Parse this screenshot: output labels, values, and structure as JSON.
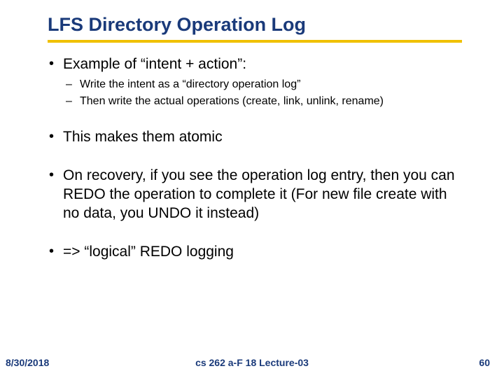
{
  "title": "LFS Directory Operation Log",
  "bullets": [
    {
      "text": "Example of “intent + action”:",
      "sub": [
        "Write the intent as a “directory operation log”",
        "Then write the actual operations (create, link, unlink, rename)"
      ]
    },
    {
      "text": "This makes them atomic",
      "sub": []
    },
    {
      "text": "On recovery, if you see the operation log entry, then you can REDO the operation to complete it (For new file create with no data, you UNDO it instead)",
      "sub": []
    },
    {
      "text": "=> “logical” REDO logging",
      "sub": []
    }
  ],
  "footer": {
    "date": "8/30/2018",
    "center": "cs 262 a-F 18 Lecture-03",
    "page": "60"
  }
}
